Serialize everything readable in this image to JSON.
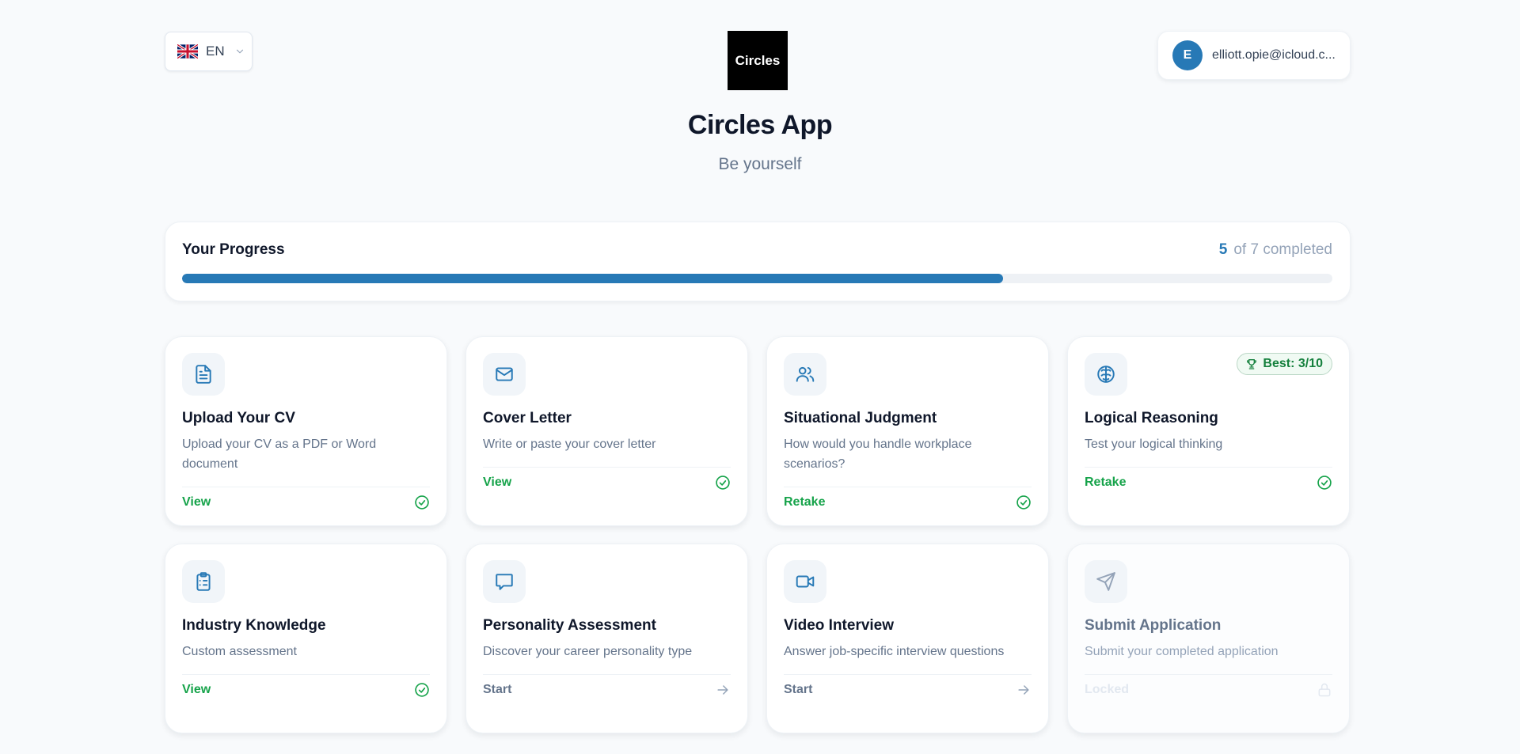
{
  "header": {
    "language": {
      "code": "EN",
      "flag_icon": "uk-flag-icon"
    },
    "logo_text": "Circles",
    "user": {
      "initial": "E",
      "email": "elliott.opie@icloud.c..."
    }
  },
  "hero": {
    "title": "Circles App",
    "subtitle": "Be yourself"
  },
  "progress": {
    "title": "Your Progress",
    "completed": "5",
    "suffix": "of 7 completed",
    "fraction": 0.714
  },
  "cards": [
    {
      "title": "Upload Your CV",
      "description": "Upload your CV as a PDF or Word document",
      "action": "View",
      "status": "completed",
      "icon": "document-icon"
    },
    {
      "title": "Cover Letter",
      "description": "Write or paste your cover letter",
      "action": "View",
      "status": "completed",
      "icon": "mail-icon"
    },
    {
      "title": "Situational Judgment",
      "description": "How would you handle workplace scenarios?",
      "action": "Retake",
      "status": "completed",
      "icon": "users-icon"
    },
    {
      "title": "Logical Reasoning",
      "description": "Test your logical thinking",
      "action": "Retake",
      "status": "completed",
      "icon": "brain-icon",
      "badge": "Best: 3/10"
    },
    {
      "title": "Industry Knowledge",
      "description": "Custom assessment",
      "action": "View",
      "status": "completed",
      "icon": "clipboard-icon"
    },
    {
      "title": "Personality Assessment",
      "description": "Discover your career personality type",
      "action": "Start",
      "status": "available",
      "icon": "chat-icon"
    },
    {
      "title": "Video Interview",
      "description": "Answer job-specific interview questions",
      "action": "Start",
      "status": "available",
      "icon": "video-icon"
    },
    {
      "title": "Submit Application",
      "description": "Submit your completed application",
      "action": "Locked",
      "status": "locked",
      "icon": "send-icon"
    }
  ],
  "colors": {
    "accent": "#2779b6",
    "success": "#16a34a",
    "background": "#f8fafc"
  }
}
